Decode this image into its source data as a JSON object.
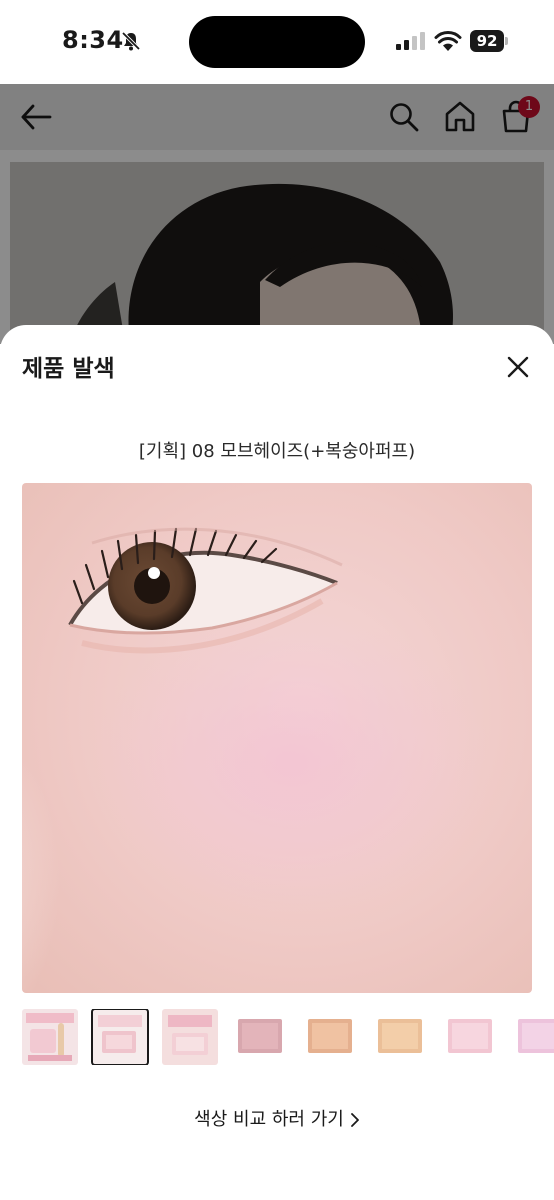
{
  "status_bar": {
    "time": "8:34",
    "battery": "92"
  },
  "header": {
    "cart_count": "1"
  },
  "sheet": {
    "title": "제품 발색",
    "product_name": "[기획] 08 모브헤이즈(+복숭아퍼프)",
    "compare_link": "색상 비교 하러 가기"
  },
  "thumbnails": [
    {
      "name": "set-with-brush"
    },
    {
      "name": "set-package-selected",
      "selected": true
    },
    {
      "name": "set-package"
    },
    {
      "name": "compact-mauve"
    },
    {
      "name": "compact-peach"
    },
    {
      "name": "compact-beige"
    },
    {
      "name": "compact-light-pink"
    },
    {
      "name": "compact-lavender"
    }
  ],
  "colors": {
    "cart_badge": "#c8102e",
    "overlay": "rgba(0,0,0,0.45)"
  },
  "icons": [
    "bell-slash-icon",
    "signal-icon",
    "wifi-icon",
    "battery-icon",
    "back-arrow-icon",
    "search-icon",
    "home-icon",
    "cart-icon",
    "close-icon",
    "chevron-right-icon"
  ]
}
